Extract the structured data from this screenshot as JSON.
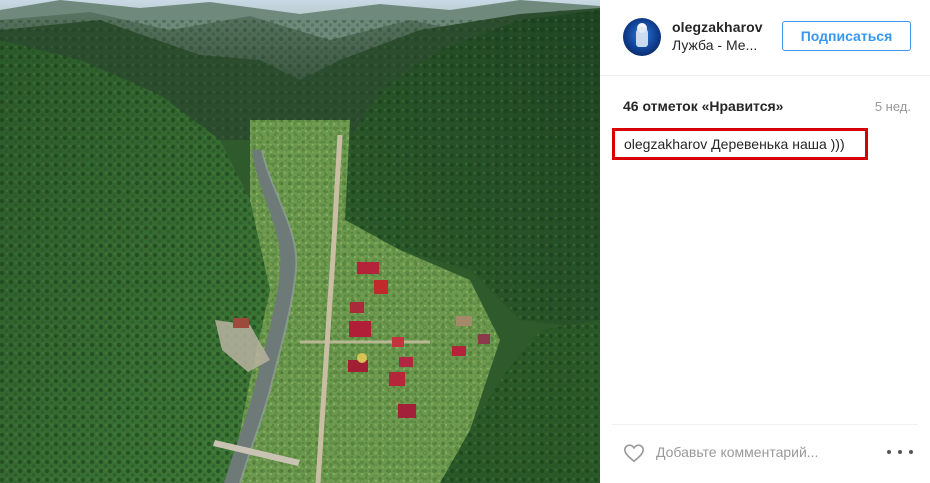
{
  "post": {
    "username": "olegzakharov",
    "location": "Лужба - Ме...",
    "subscribe_label": "Подписаться",
    "likes": "46 отметок «Нравится»",
    "time_ago": "5 нед.",
    "caption_user": "olegzakharov",
    "caption_text": "Деревенька наша )))",
    "comment_placeholder": "Добавьте комментарий..."
  },
  "colors": {
    "accent_blue": "#3897f0",
    "highlight_red": "#d60000",
    "muted_gray": "#999999"
  },
  "icons": {
    "like": "heart-outline-icon",
    "more": "more-options-icon"
  }
}
